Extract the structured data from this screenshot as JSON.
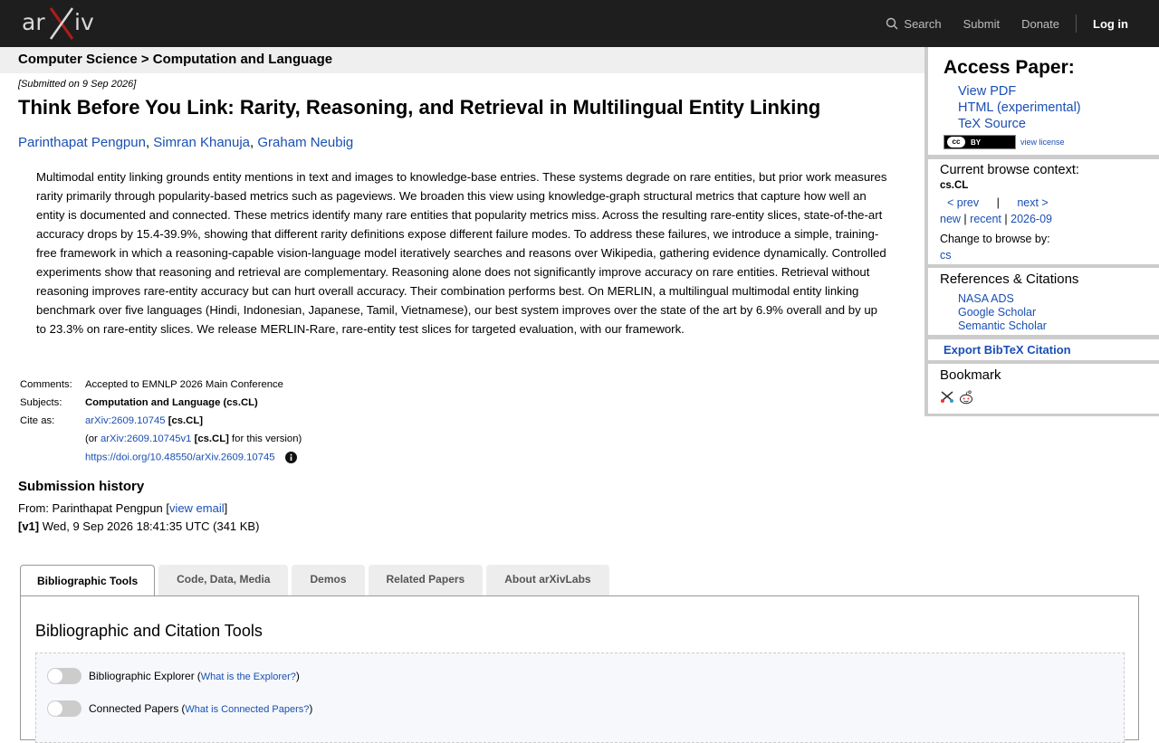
{
  "topbar": {
    "logo_text": "arXiv",
    "search_label": "Search",
    "submit_label": "Submit",
    "donate_label": "Donate",
    "login_label": "Log in"
  },
  "breadcrumb": "Computer Science > Computation and Language",
  "paper": {
    "dateline": "[Submitted on 9 Sep 2026]",
    "title": "Think Before You Link: Rarity, Reasoning, and Retrieval in Multilingual Entity Linking",
    "authors": [
      "Parinthapat Pengpun",
      "Simran Khanuja",
      "Graham Neubig"
    ],
    "abstract": "Multimodal entity linking grounds entity mentions in text and images to knowledge-base entries. These systems degrade on rare entities, but prior work measures rarity primarily through popularity-based metrics such as pageviews. We broaden this view using knowledge-graph structural metrics that capture how well an entity is documented and connected. These metrics identify many rare entities that popularity metrics miss. Across the resulting rare-entity slices, state-of-the-art accuracy drops by 15.4-39.9%, showing that different rarity definitions expose different failure modes. To address these failures, we introduce a simple, training-free framework in which a reasoning-capable vision-language model iteratively searches and reasons over Wikipedia, gathering evidence dynamically. Controlled experiments show that reasoning and retrieval are complementary. Reasoning alone does not significantly improve accuracy on rare entities. Retrieval without reasoning improves rare-entity accuracy but can hurt overall accuracy. Their combination performs best. On MERLIN, a multilingual multimodal entity linking benchmark over five languages (Hindi, Indonesian, Japanese, Tamil, Vietnamese), our best system improves over the state of the art by 6.9% overall and by up to 23.3% on rare-entity slices. We release MERLIN-Rare, rare-entity test slices for targeted evaluation, with our framework."
  },
  "meta": {
    "comments_label": "Comments:",
    "comments": "Accepted to EMNLP 2026 Main Conference",
    "subjects_label": "Subjects:",
    "subjects": "Computation and Language (cs.CL)",
    "cite_label": "Cite as:",
    "cite_id": "arXiv:2609.10745",
    "cite_cat": "[cs.CL]",
    "or_prefix": "(or",
    "cite_v1": "arXiv:2609.10745v1",
    "cite_v1_cat": "[cs.CL]",
    "cite_v1_suffix": "for this version)",
    "doi": "https://doi.org/10.48550/arXiv.2609.10745"
  },
  "history": {
    "heading": "Submission history",
    "from_prefix": "From: Parinthapat Pengpun [",
    "view_email": "view email",
    "from_suffix": "]",
    "v1_label": "[v1]",
    "v1_text": "Wed, 9 Sep 2026 18:41:35 UTC (341 KB)"
  },
  "tabs": [
    "Bibliographic Tools",
    "Code, Data, Media",
    "Demos",
    "Related Papers",
    "About arXivLabs"
  ],
  "tabpanel": {
    "heading": "Bibliographic and Citation Tools",
    "tools": [
      {
        "label": "Bibliographic Explorer",
        "help": "What is the Explorer?"
      },
      {
        "label": "Connected Papers",
        "help": "What is Connected Papers?"
      }
    ]
  },
  "sidebar": {
    "access_heading": "Access Paper:",
    "downloads": [
      "View PDF",
      "HTML (experimental)",
      "TeX Source"
    ],
    "license_badge": "BY",
    "view_license": "view license",
    "context_heading": "Current browse context:",
    "context_cat": "cs.CL",
    "prev": "< prev",
    "nav_sep": "|",
    "next": "next >",
    "new": "new",
    "recent": "recent",
    "month": "2026-09",
    "change_label": "Change to browse by:",
    "change_cat": "cs",
    "refs_heading": "References & Citations",
    "refs": [
      "NASA ADS",
      "Google Scholar",
      "Semantic Scholar"
    ],
    "bibtex": "Export BibTeX Citation",
    "bookmark_heading": "Bookmark"
  },
  "colors": {
    "topbar": "#1e1e1e",
    "logo_x": "#b31b1b",
    "link": "#1a4fb3"
  }
}
